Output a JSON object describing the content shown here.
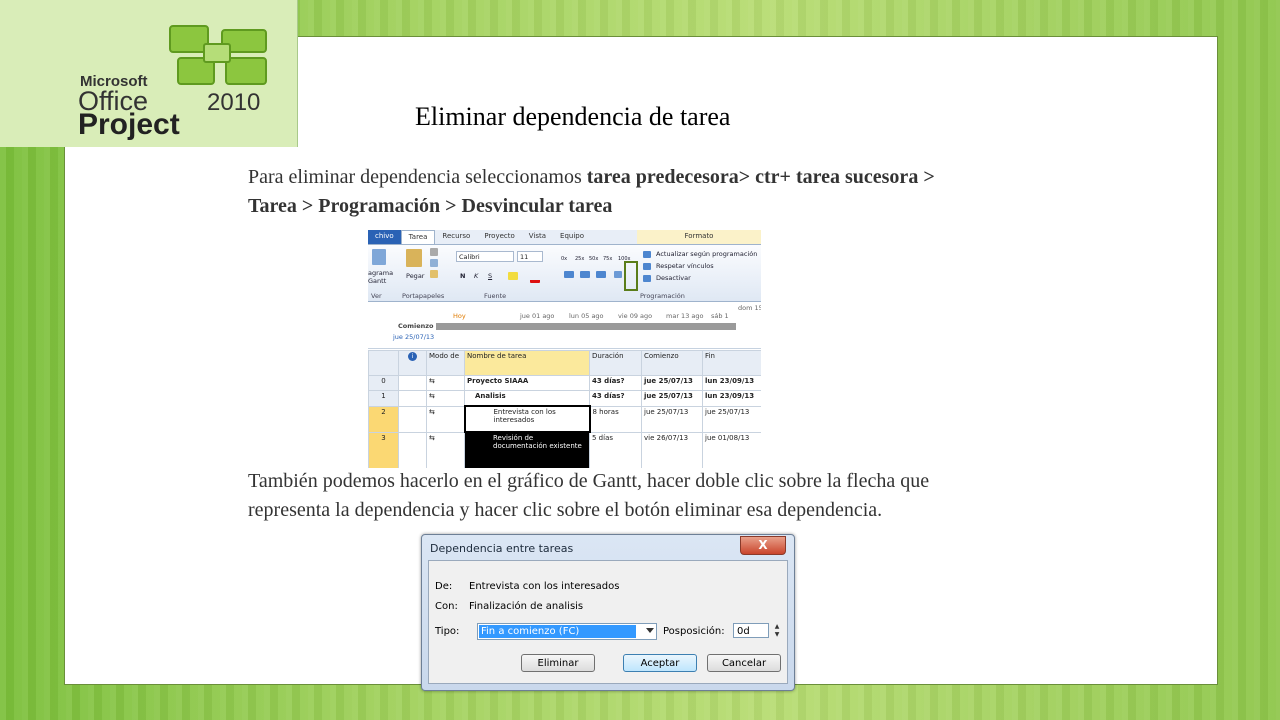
{
  "logo": {
    "brand": "Microsoft",
    "product": "Office",
    "version": "2010",
    "app": "Project"
  },
  "slide": {
    "title": "Eliminar dependencia de tarea",
    "para1_plain": "Para eliminar dependencia seleccionamos ",
    "para1_bold": "tarea predecesora> ctr+ tarea sucesora  > Tarea > Programación > Desvincular tarea",
    "para2": "También podemos hacerlo en el gráfico de Gantt, hacer doble clic sobre la flecha que representa la dependencia y hacer clic sobre el botón eliminar esa dependencia."
  },
  "ribbon": {
    "tabs": [
      "chivo",
      "Tarea",
      "Recurso",
      "Proyecto",
      "Vista",
      "Equipo",
      "Formato"
    ],
    "groups": {
      "ver": "Ver",
      "portapapeles": "Portapapeles",
      "fuente": "Fuente",
      "programacion": "Programación"
    },
    "gantt_label": "agrama Gantt",
    "pegar": "Pegar",
    "font_name": "Calibri",
    "font_size": "11",
    "percent_buttons": [
      "0x",
      "25x",
      "50x",
      "75x",
      "100x"
    ],
    "commands": [
      "Actualizar según programación",
      "Respetar vínculos",
      "Desactivar"
    ],
    "format_buttons": [
      "N",
      "K",
      "S"
    ]
  },
  "timeline": {
    "today": "Hoy",
    "dates": [
      "jue 01 ago",
      "lun 05 ago",
      "vie 09 ago",
      "mar 13 ago",
      "sáb 1"
    ],
    "top_right": "dom 15",
    "start_label": "Comienzo",
    "start_date": "jue 25/07/13"
  },
  "grid": {
    "headers": [
      "",
      "Modo de",
      "Nombre de tarea",
      "Duración",
      "Comienzo",
      "Fin"
    ],
    "rows": [
      {
        "id": "0",
        "name": "Proyecto SIAAA",
        "duration": "43 días?",
        "start": "jue 25/07/13",
        "end": "lun 23/09/13"
      },
      {
        "id": "1",
        "name": "Analisis",
        "duration": "43 días?",
        "start": "jue 25/07/13",
        "end": "lun 23/09/13"
      },
      {
        "id": "2",
        "name": "Entrevista con los interesados",
        "duration": "8 horas",
        "start": "jue 25/07/13",
        "end": "jue 25/07/13"
      },
      {
        "id": "3",
        "name": "Revisión de documentación existente",
        "duration": "5 días",
        "start": "vie 26/07/13",
        "end": "jue 01/08/13"
      }
    ]
  },
  "dialog": {
    "title": "Dependencia entre tareas",
    "close": "X",
    "de_label": "De:",
    "de_value": "Entrevista con los interesados",
    "con_label": "Con:",
    "con_value": "Finalización de analisis",
    "tipo_label": "Tipo:",
    "tipo_value": "Fin a comienzo (FC)",
    "pos_label": "Posposición:",
    "pos_value": "0d",
    "buttons": {
      "eliminar": "Eliminar",
      "aceptar": "Aceptar",
      "cancelar": "Cancelar"
    }
  }
}
